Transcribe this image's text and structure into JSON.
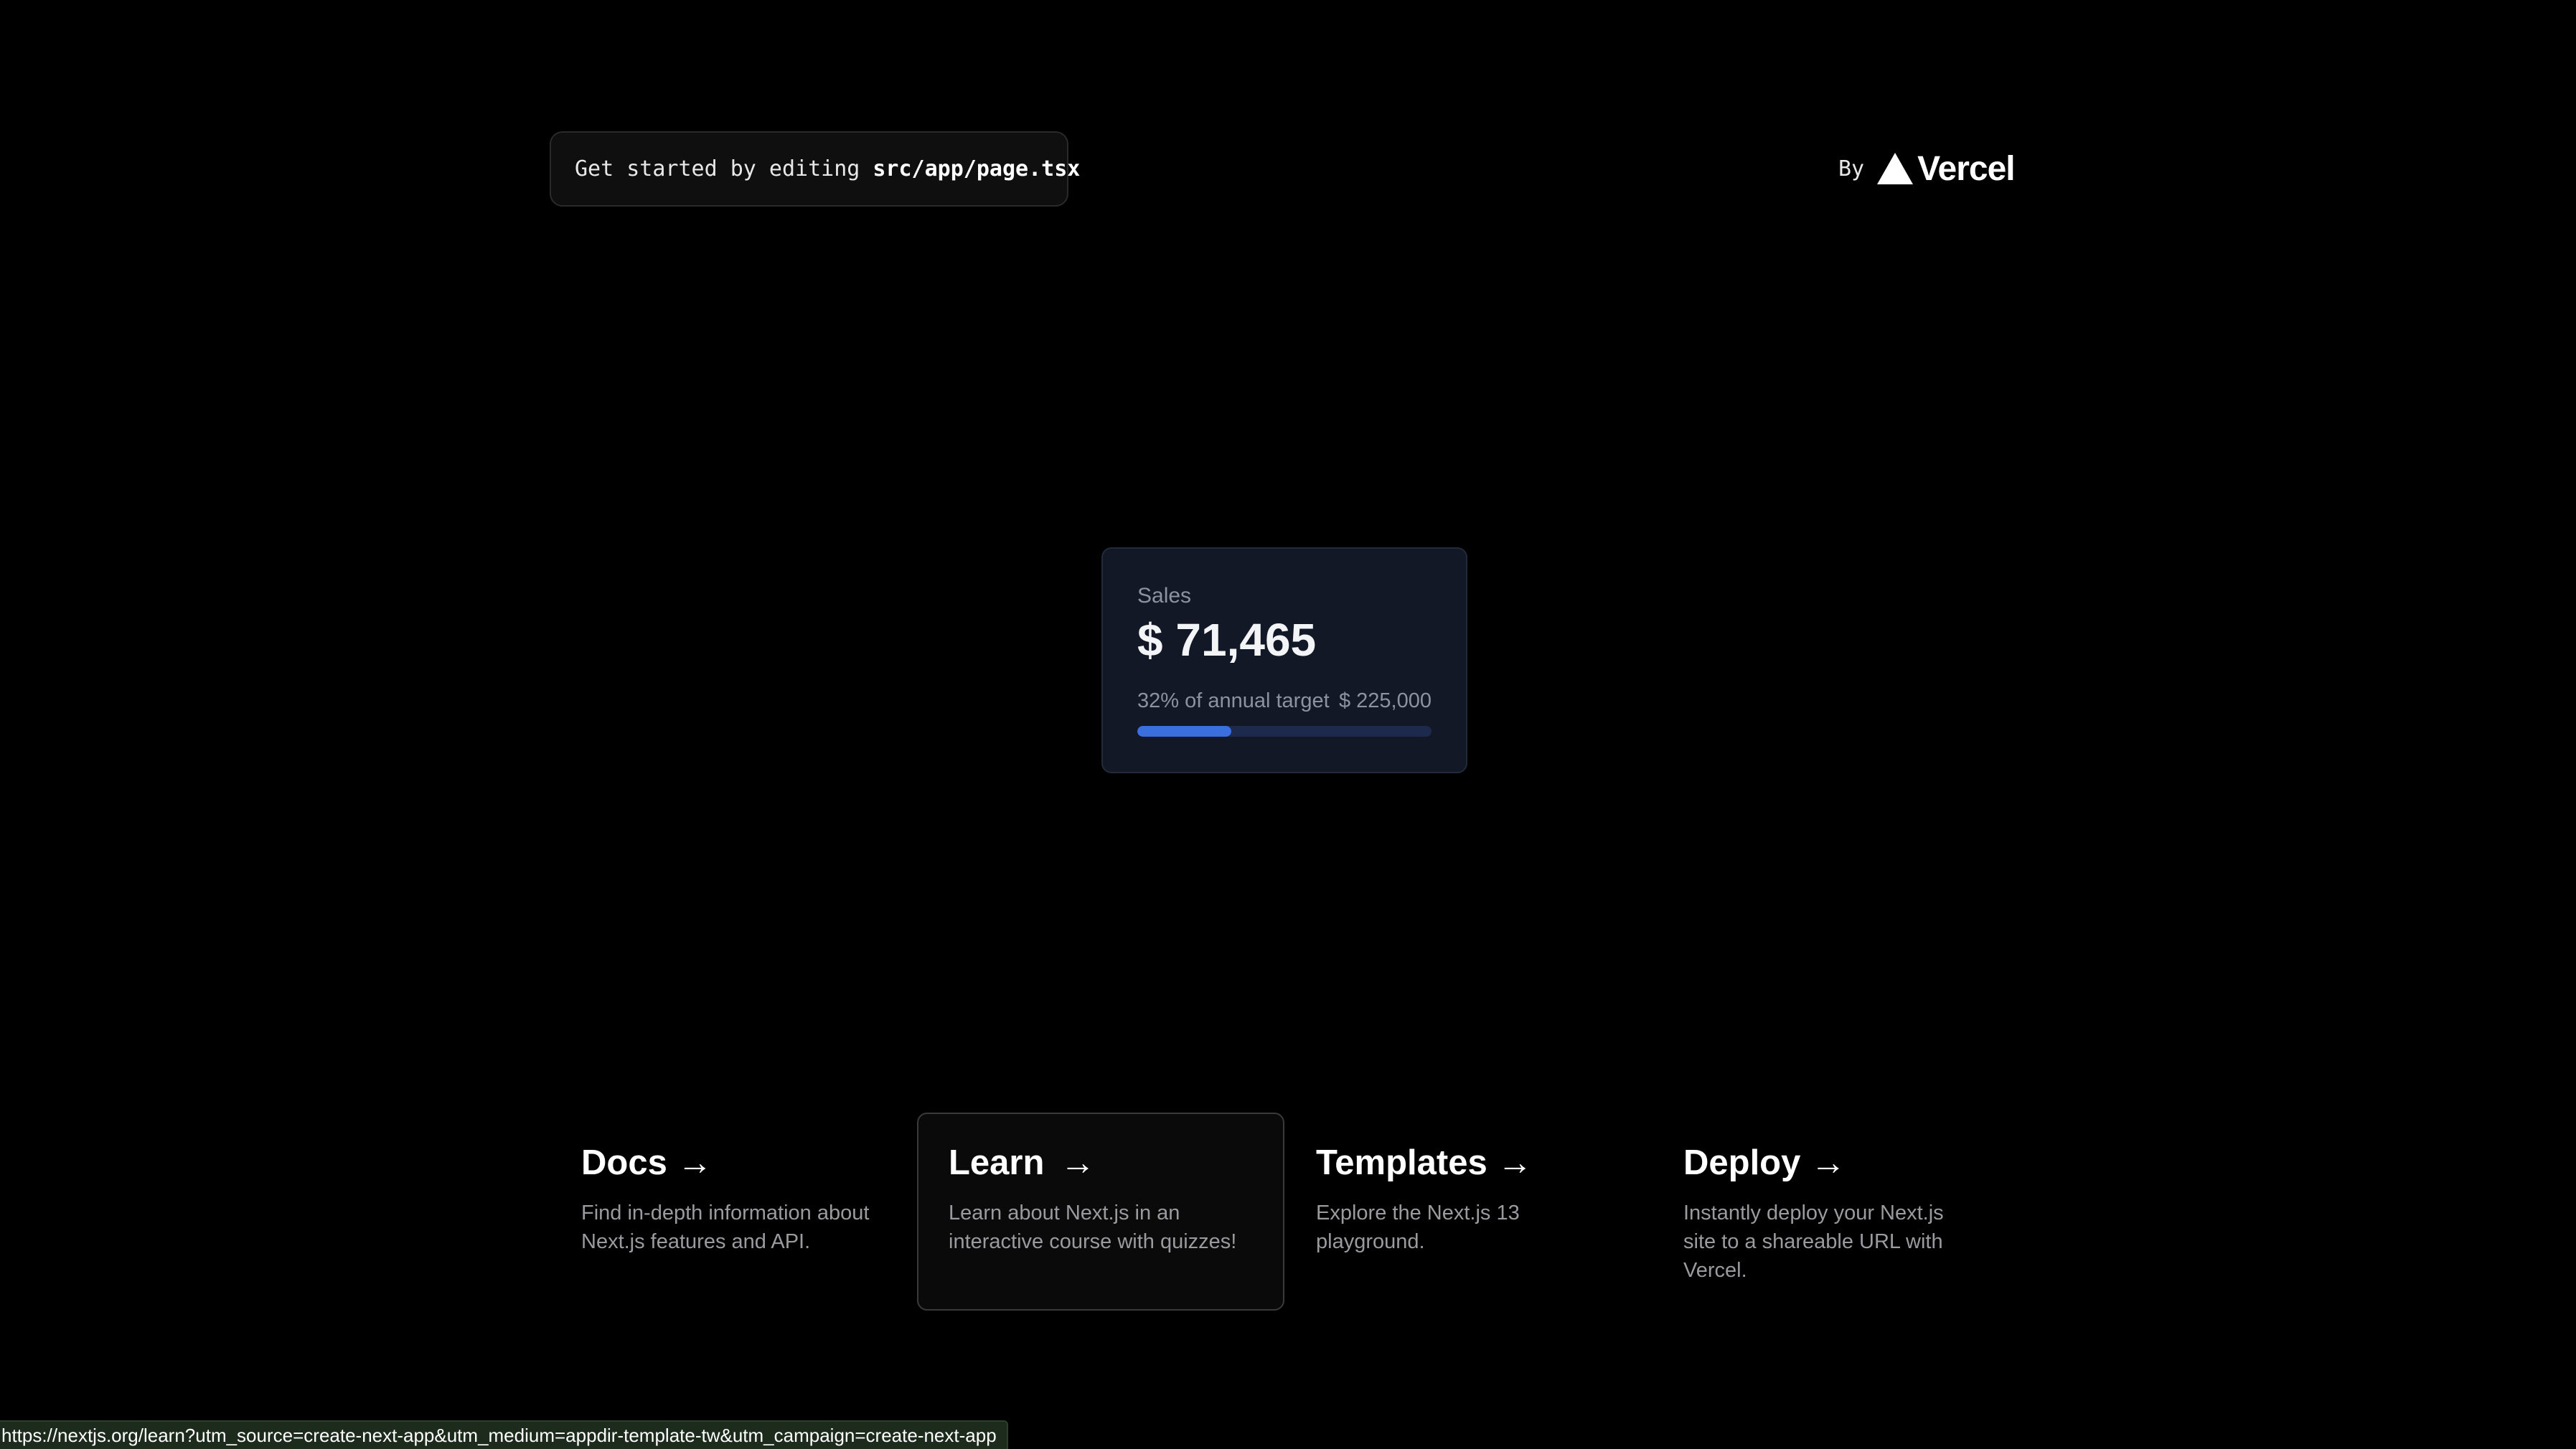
{
  "header": {
    "intro_text": "Get started by editing",
    "file_path": "src/app/page.tsx",
    "by_text": "By",
    "brand_name": "Vercel"
  },
  "kpi": {
    "title": "Sales",
    "value": "$ 71,465",
    "target_text": "32% of annual target",
    "target_value": "$ 225,000",
    "progress_percent": 32
  },
  "cards": [
    {
      "title": "Docs",
      "arrow": "->",
      "description": "Find in-depth information about Next.js features and API."
    },
    {
      "title": "Learn",
      "arrow": "->",
      "description": "Learn about Next.js in an interactive course with quizzes!"
    },
    {
      "title": "Templates",
      "arrow": "->",
      "description": "Explore the Next.js 13 playground."
    },
    {
      "title": "Deploy",
      "arrow": "->",
      "description": "Instantly deploy your Next.js site to a shareable URL with Vercel."
    }
  ],
  "status_bar": {
    "url": "https://nextjs.org/learn?utm_source=create-next-app&utm_medium=appdir-template-tw&utm_campaign=create-next-app"
  },
  "colors": {
    "background": "#000000",
    "card_background": "#121826",
    "progress_fill": "#3b6fe0",
    "progress_track": "#1e2a4d"
  },
  "icons": {
    "brand_logo": "vercel-triangle-icon",
    "card_arrow": "arrow-right-icon"
  }
}
